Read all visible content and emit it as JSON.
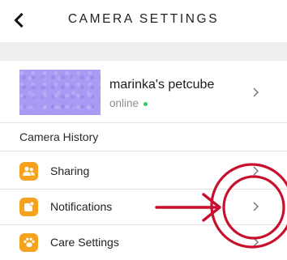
{
  "header": {
    "title": "CAMERA SETTINGS",
    "back_icon": "chevron-left-icon"
  },
  "camera": {
    "name": "marinka's petcube",
    "status": "online",
    "status_color": "#2fcf6b",
    "thumbnail_color": "#a99af3"
  },
  "camera_history": {
    "label": "Camera History"
  },
  "menu": {
    "items": [
      {
        "label": "Sharing",
        "icon": "people-icon"
      },
      {
        "label": "Notifications",
        "icon": "notification-bell-icon"
      },
      {
        "label": "Care Settings",
        "icon": "paw-icon"
      }
    ]
  },
  "colors": {
    "accent": "#f5a21e",
    "annotation": "#c8102e",
    "section_background": "#eeeeef"
  }
}
